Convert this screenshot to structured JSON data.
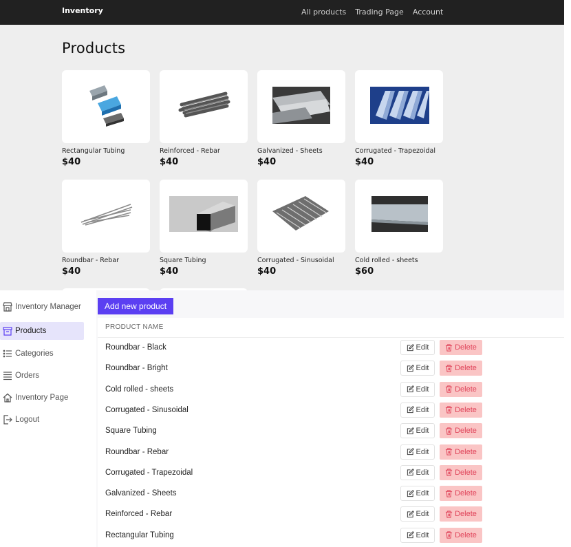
{
  "topnav": {
    "brand": "Inventory",
    "links": [
      "All products",
      "Trading Page",
      "Account"
    ]
  },
  "shop": {
    "title": "Products",
    "products": [
      {
        "name": "Rectangular Tubing",
        "price": "$40",
        "image": "rectangular-tubing-image"
      },
      {
        "name": "Reinforced - Rebar",
        "price": "$40",
        "image": "rebar-bundle-image"
      },
      {
        "name": "Galvanized - Sheets",
        "price": "$40",
        "image": "galvanized-sheets-image"
      },
      {
        "name": "Corrugated - Trapezoidal",
        "price": "$40",
        "image": "trapezoidal-roofing-image"
      },
      {
        "name": "Roundbar - Rebar",
        "price": "$40",
        "image": "roundbar-image"
      },
      {
        "name": "Square Tubing",
        "price": "$40",
        "image": "square-tubing-image"
      },
      {
        "name": "Corrugated - Sinusoidal",
        "price": "$40",
        "image": "sinusoidal-sheets-image"
      },
      {
        "name": "Cold rolled - sheets",
        "price": "$60",
        "image": "cold-rolled-sheets-image"
      }
    ]
  },
  "sidebar": {
    "title": "Inventory Manager",
    "items": [
      {
        "label": "Products",
        "icon": "archive-icon",
        "active": true
      },
      {
        "label": "Categories",
        "icon": "list-icon",
        "active": false
      },
      {
        "label": "Orders",
        "icon": "menu-icon",
        "active": false
      },
      {
        "label": "Inventory Page",
        "icon": "home-icon",
        "active": false
      },
      {
        "label": "Logout",
        "icon": "logout-icon",
        "active": false
      }
    ]
  },
  "admin": {
    "add_button": "Add new product",
    "column_header": "PRODUCT NAME",
    "edit_label": "Edit",
    "delete_label": "Delete",
    "rows": [
      "Roundbar - Black",
      "Roundbar - Bright",
      "Cold rolled - sheets",
      "Corrugated - Sinusoidal",
      "Square Tubing",
      "Roundbar - Rebar",
      "Corrugated - Trapezoidal",
      "Galvanized - Sheets",
      "Reinforced - Rebar",
      "Rectangular Tubing"
    ]
  },
  "colors": {
    "accent": "#5b3ff2",
    "nav_bg": "#212121",
    "delete_bg": "#fac5c5",
    "delete_text": "#e0445a",
    "active_item_bg": "#e6e4fb"
  }
}
